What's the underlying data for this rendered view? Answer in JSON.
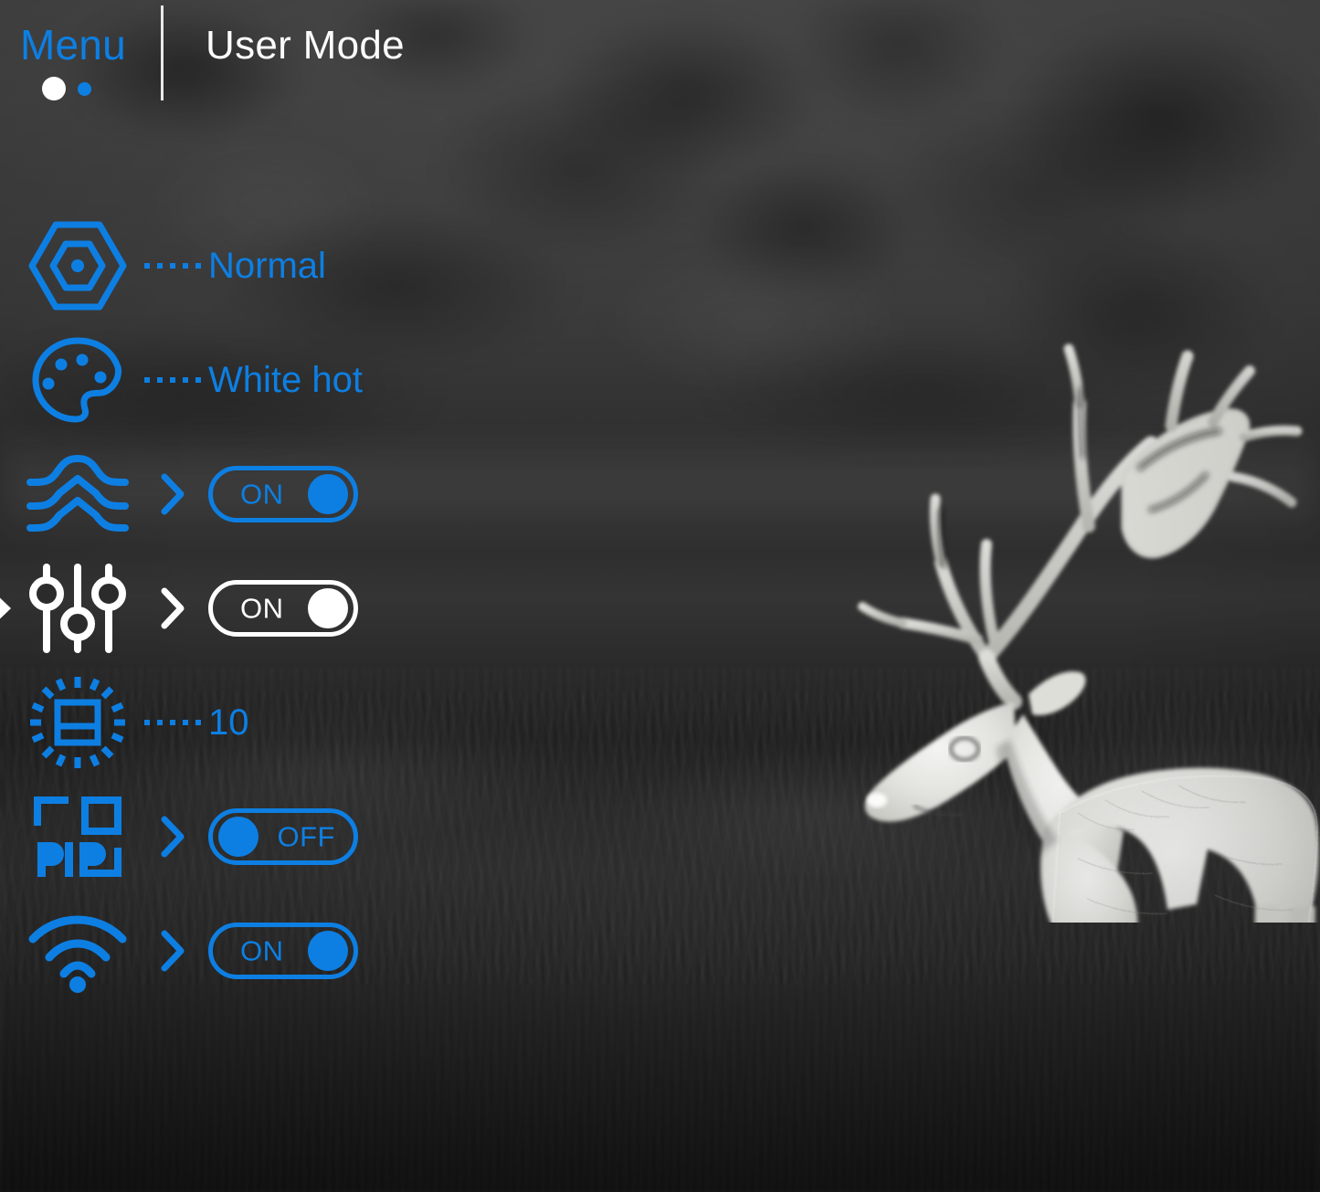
{
  "header": {
    "menu_label": "Menu",
    "mode_title": "User Mode",
    "page_dots": [
      {
        "name": "page-1",
        "state": "active"
      },
      {
        "name": "page-2",
        "state": "inactive"
      }
    ]
  },
  "theme": {
    "accent_blue": "#0d7fe3",
    "selected_white": "#ffffff"
  },
  "menu": {
    "rows": [
      {
        "icon": "scene-mode-hexagon-icon",
        "name": "menu-row-scene-mode",
        "control": "value",
        "value": "Normal",
        "selected": false
      },
      {
        "icon": "palette-icon",
        "name": "menu-row-color-palette",
        "control": "value",
        "value": "White hot",
        "selected": false
      },
      {
        "icon": "image-detail-waves-icon",
        "name": "menu-row-image-detail",
        "control": "toggle",
        "value": "ON",
        "selected": false
      },
      {
        "icon": "image-adjust-sliders-icon",
        "name": "menu-row-image-adjustment",
        "control": "toggle",
        "value": "ON",
        "selected": true
      },
      {
        "icon": "brightness-icon",
        "name": "menu-row-brightness",
        "control": "value",
        "value": "10",
        "selected": false
      },
      {
        "icon": "pip-icon",
        "name": "menu-row-picture-in-picture",
        "control": "toggle",
        "value": "OFF",
        "selected": false
      },
      {
        "icon": "wifi-icon",
        "name": "menu-row-wifi",
        "control": "toggle",
        "value": "ON",
        "selected": false
      }
    ]
  },
  "scene": {
    "subject": "deer",
    "palette": "white-hot"
  }
}
